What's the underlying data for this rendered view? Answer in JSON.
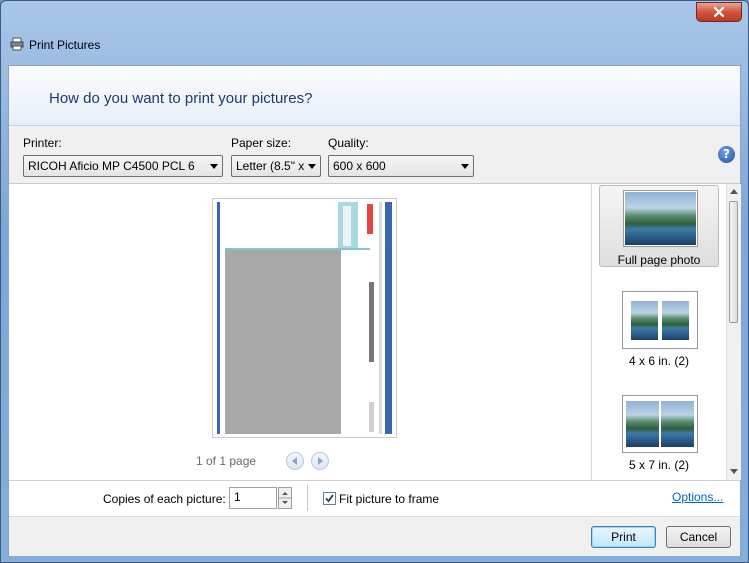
{
  "window": {
    "title": "Print Pictures"
  },
  "header": {
    "question": "How do you want to print your pictures?"
  },
  "toolbar": {
    "printer_label": "Printer:",
    "printer_value": "RICOH Aficio MP C4500 PCL 6",
    "paper_size_label": "Paper size:",
    "paper_size_value": "Letter (8.5\" x",
    "quality_label": "Quality:",
    "quality_value": "600 x 600",
    "help_glyph": "?"
  },
  "preview": {
    "page_indicator": "1 of 1 page"
  },
  "layouts": [
    {
      "label": "Full page photo",
      "selected": true
    },
    {
      "label": "4 x 6 in. (2)",
      "selected": false
    },
    {
      "label": "5 x 7 in. (2)",
      "selected": false
    }
  ],
  "options_bar": {
    "copies_label": "Copies of each picture:",
    "copies_value": "1",
    "fit_label": "Fit picture to frame",
    "fit_checked": true,
    "options_link": "Options..."
  },
  "footer": {
    "print_label": "Print",
    "cancel_label": "Cancel"
  },
  "colors": {
    "header_text": "#1e3b6e",
    "link": "#0066cc",
    "close_button": "#c0391f"
  }
}
